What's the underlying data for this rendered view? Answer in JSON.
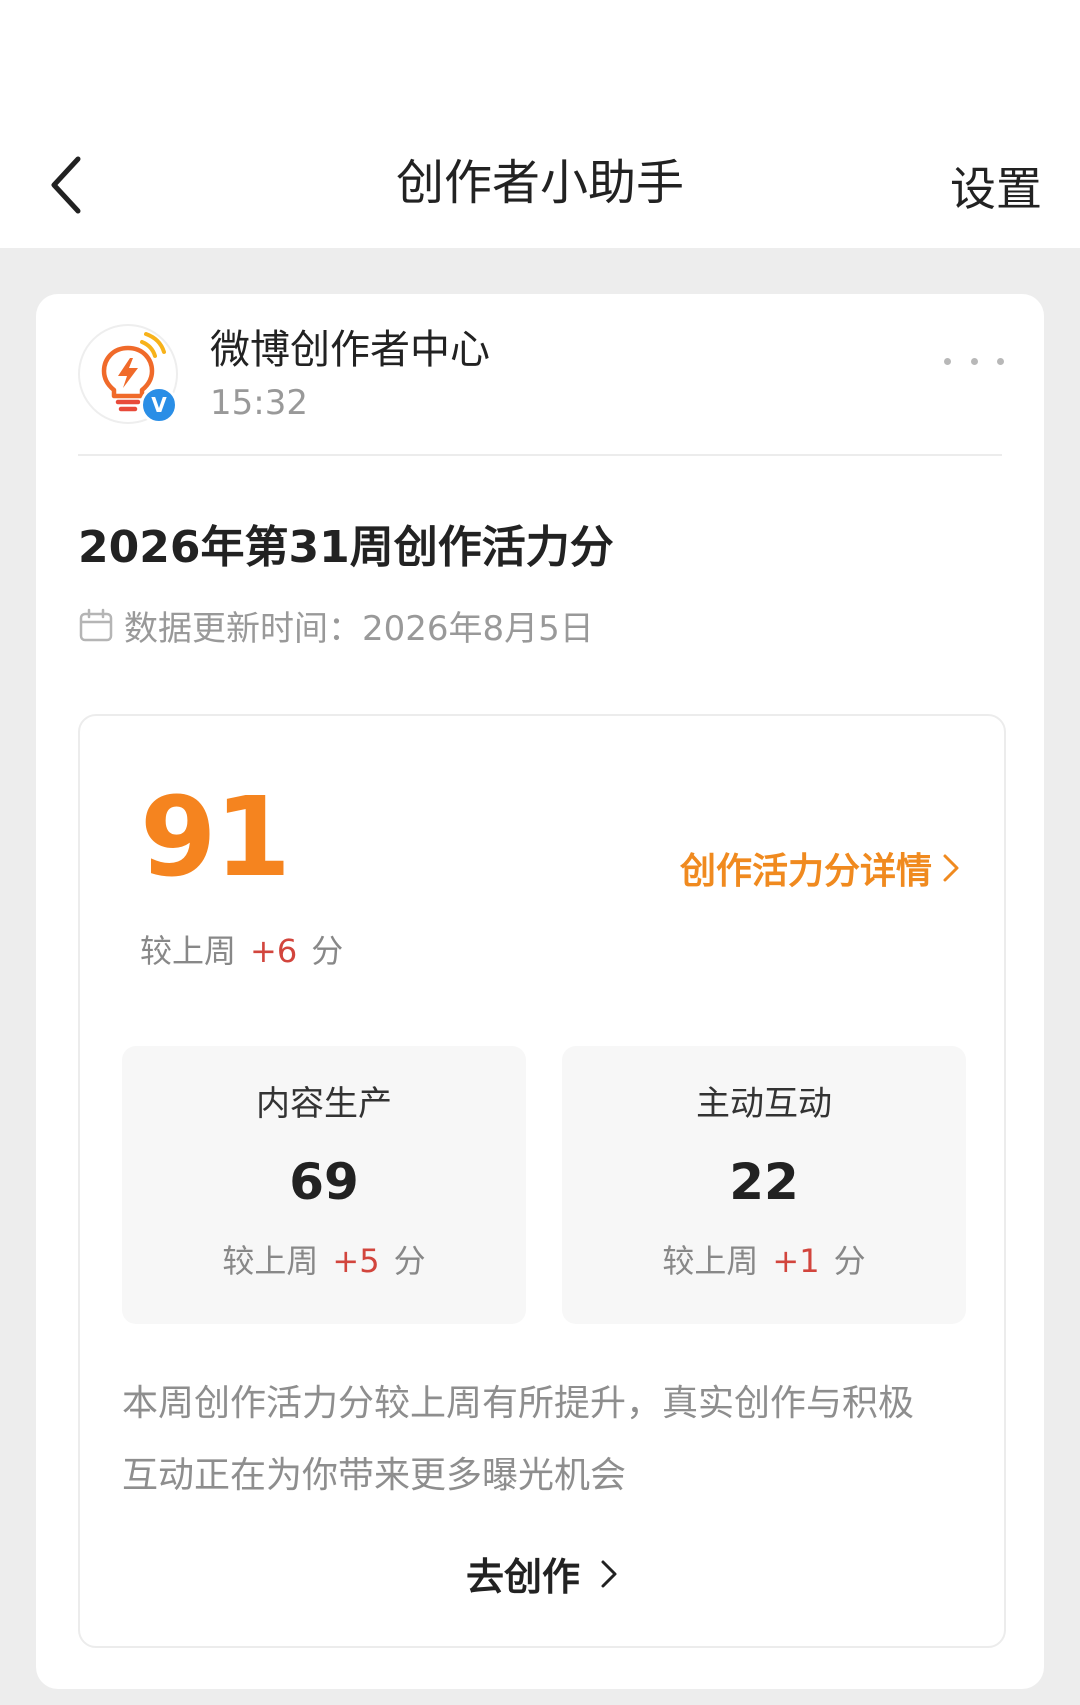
{
  "nav": {
    "title": "创作者小助手",
    "settings_label": "设置"
  },
  "post": {
    "account_name": "微博创作者中心",
    "time": "15:32",
    "title": "2026年第31周创作活力分",
    "update_text": "数据更新时间：2026年8月5日"
  },
  "score": {
    "total": "91",
    "detail_link": "创作活力分详情",
    "compare_prefix": "较上周",
    "compare_delta": "+6",
    "compare_unit": "分",
    "content": {
      "label": "内容生产",
      "value": "69",
      "compare_prefix": "较上周",
      "delta": "+5",
      "unit": "分"
    },
    "interaction": {
      "label": "主动互动",
      "value": "22",
      "compare_prefix": "较上周",
      "delta": "+1",
      "unit": "分"
    },
    "summary": "本周创作活力分较上周有所提升，真实创作与积极互动正在为你带来更多曝光机会",
    "cta_label": "去创作"
  },
  "colors": {
    "accent_orange": "#f5841f",
    "delta_red": "#d2453d",
    "verified_blue": "#2a8ee6"
  },
  "icons": {
    "back": "chevron-left-icon",
    "more": "more-dots-icon",
    "calendar": "calendar-icon",
    "avatar_logo": "lightbulb-lightning-icon",
    "verified": "verified-badge-icon"
  }
}
